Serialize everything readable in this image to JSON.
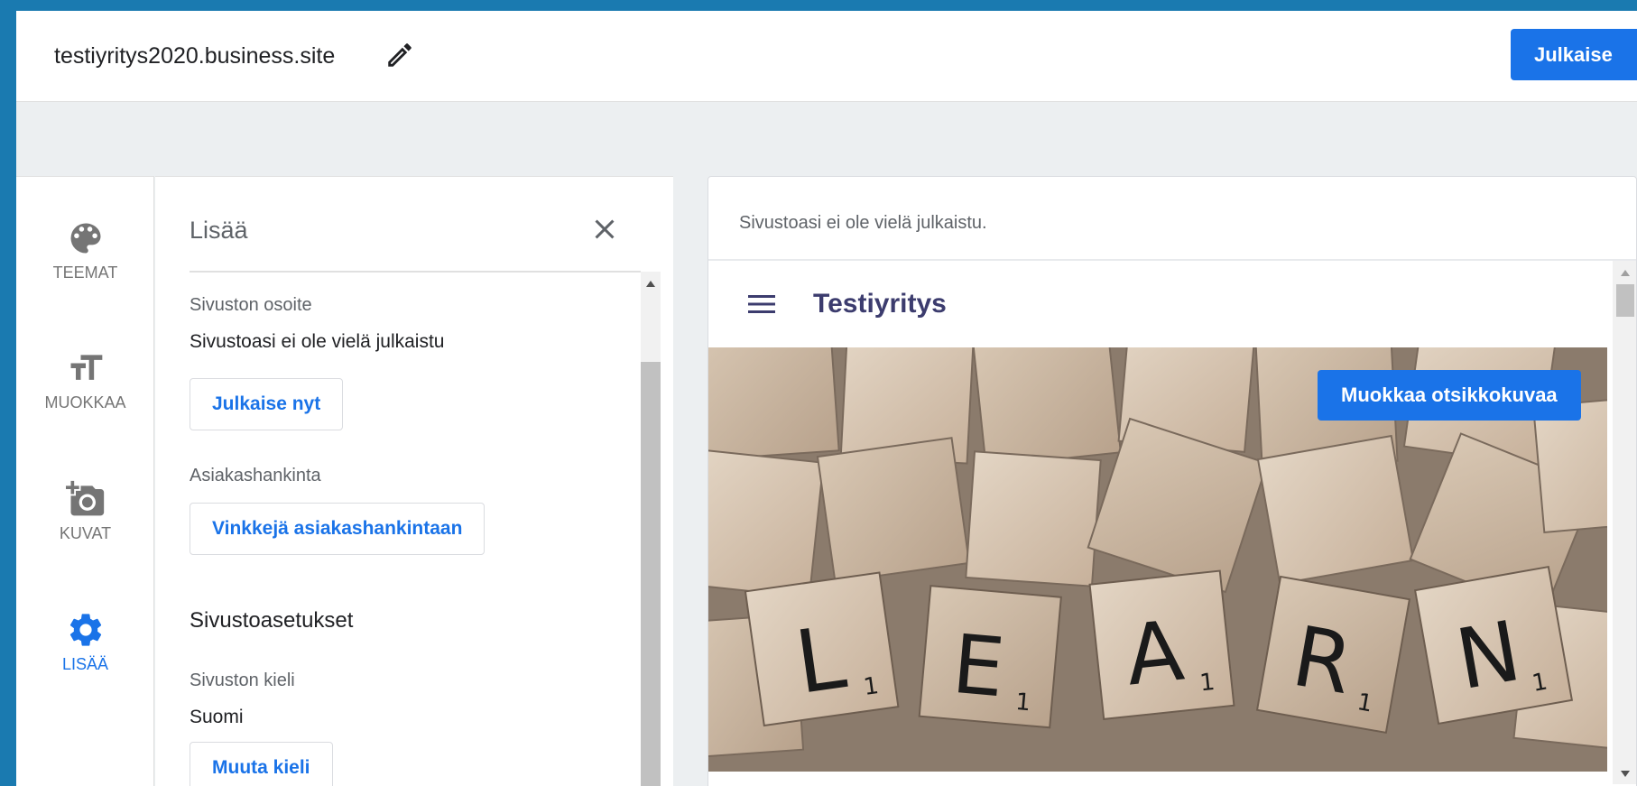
{
  "topbar": {
    "site_url": "testiyritys2020.business.site",
    "edit_icon": "pencil-icon",
    "publish_label": "Julkaise",
    "accent": "#1a73e8"
  },
  "rail": {
    "items": [
      {
        "label": "TEEMAT",
        "icon": "palette-icon"
      },
      {
        "label": "MUOKKAA",
        "icon": "text-size-icon"
      },
      {
        "label": "KUVAT",
        "icon": "add-photo-icon"
      },
      {
        "label": "LISÄÄ",
        "icon": "gear-icon",
        "active": true
      }
    ]
  },
  "panel": {
    "title": "Lisää",
    "close_icon": "close-icon",
    "address_label": "Sivuston osoite",
    "address_value": "Sivustoasi ei ole vielä julkaistu",
    "publish_now": "Julkaise nyt",
    "acquisition_label": "Asiakashankinta",
    "acquisition_button": "Vinkkejä asiakashankintaan",
    "settings_heading": "Sivustoasetukset",
    "language_label": "Sivuston kieli",
    "language_value": "Suomi",
    "change_language": "Muuta kieli"
  },
  "preview": {
    "notice": "Sivustoasi ei ole vielä julkaistu.",
    "site_title": "Testiyritys",
    "menu_icon": "hamburger-menu-icon",
    "edit_header_image": "Muokkaa otsikkokuvaa",
    "hero_tiles": [
      {
        "letter": "L",
        "points": "1"
      },
      {
        "letter": "E",
        "points": "1"
      },
      {
        "letter": "A",
        "points": "1"
      },
      {
        "letter": "R",
        "points": "1"
      },
      {
        "letter": "N",
        "points": "1"
      }
    ]
  }
}
